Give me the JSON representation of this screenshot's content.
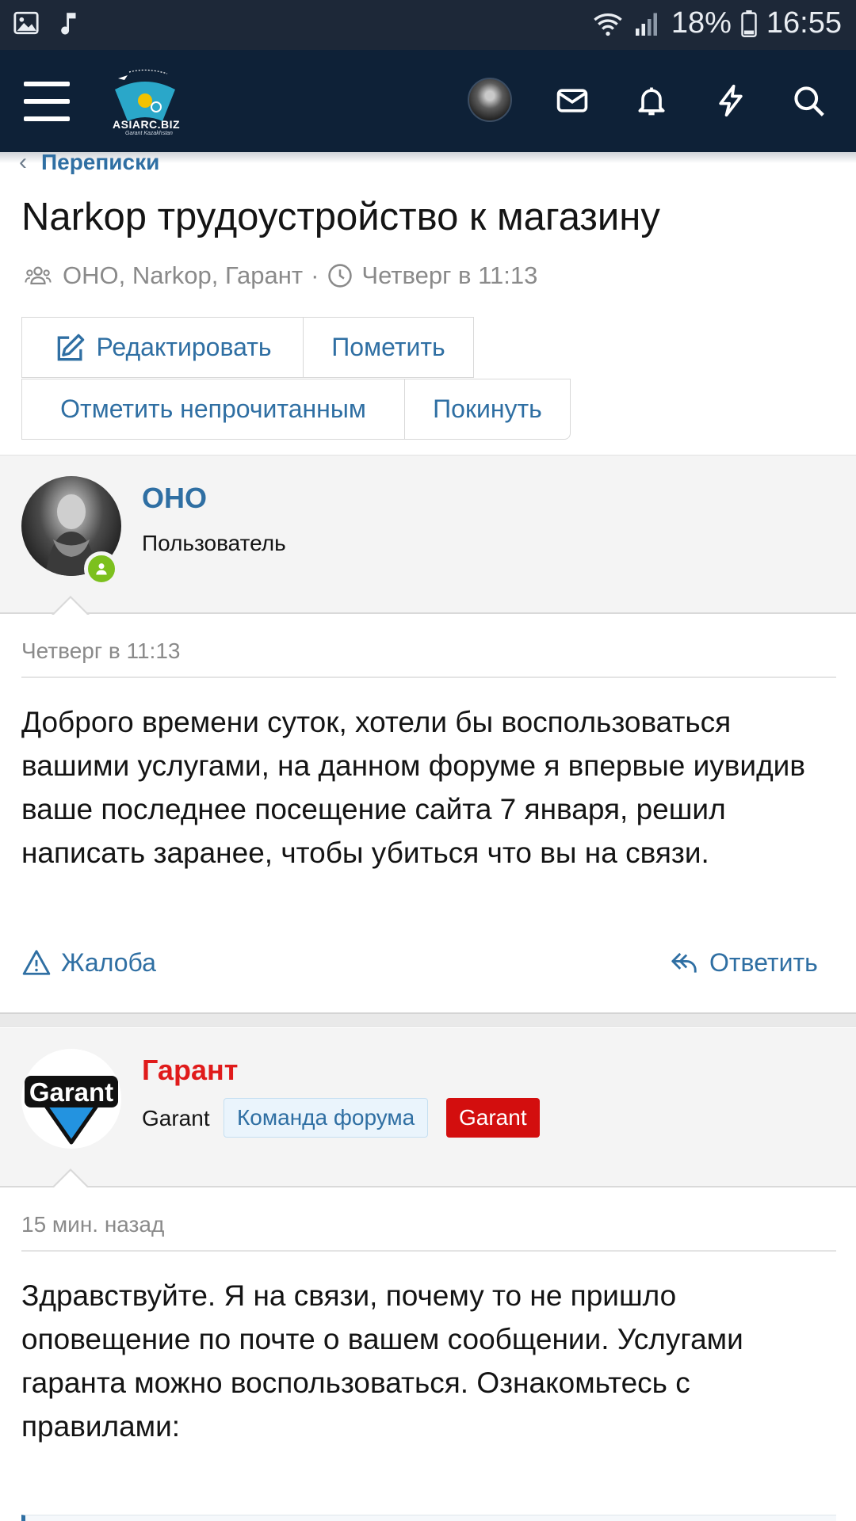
{
  "status_bar": {
    "battery": "18%",
    "time": "16:55",
    "icons": [
      "image-icon",
      "music-note-icon",
      "wifi-icon",
      "signal-icon",
      "battery-icon"
    ]
  },
  "app_bar": {
    "logo_text": "ASIARC.BIZ",
    "logo_subtext": "Garant Kazakhstan",
    "icons": [
      "menu-icon",
      "avatar",
      "mail-icon",
      "bell-icon",
      "lightning-icon",
      "search-icon"
    ]
  },
  "breadcrumb": {
    "label": "Переписки"
  },
  "conversation": {
    "title": "Narkop трудоустройство к магазину",
    "participants": "ОНО, Narkop, Гарант",
    "separator": "·",
    "date": "Четверг в 11:13"
  },
  "buttons": {
    "edit": "Редактировать",
    "mark": "Пометить",
    "mark_unread": "Отметить непрочитанным",
    "leave": "Покинуть"
  },
  "messages": [
    {
      "username": "ОНО",
      "user_title": "Пользователь",
      "date": "Четверг в 11:13",
      "body": "Доброго времени суток, хотели бы воспользоваться вашими услугами, на данном форуме я впервые иувидив ваше последнее посещение сайта 7 января, решил написать заранее, чтобы убиться что вы на связи.",
      "report": "Жалоба",
      "reply": "Ответить",
      "colors": {
        "username": "#2f6fa3"
      }
    },
    {
      "username": "Гарант",
      "user_title": "Garant",
      "badges": [
        "Команда форума",
        "Garant"
      ],
      "date": "15 мин. назад",
      "body": "Здравствуйте. Я на связи, почему то не пришло оповещение по почте о вашем сообщении. Услугами гаранта можно воспользоваться. Ознакомьтесь с правилами:",
      "colors": {
        "username": "#e01b1b",
        "badge_team_bg": "#eaf4fc",
        "badge_garant_bg": "#d30e0e"
      }
    }
  ],
  "colors": {
    "status_bar": "#1d2838",
    "app_bar": "#0e2137",
    "link": "#2f6fa3",
    "muted": "#8a8a8a",
    "online": "#7cc01e"
  }
}
